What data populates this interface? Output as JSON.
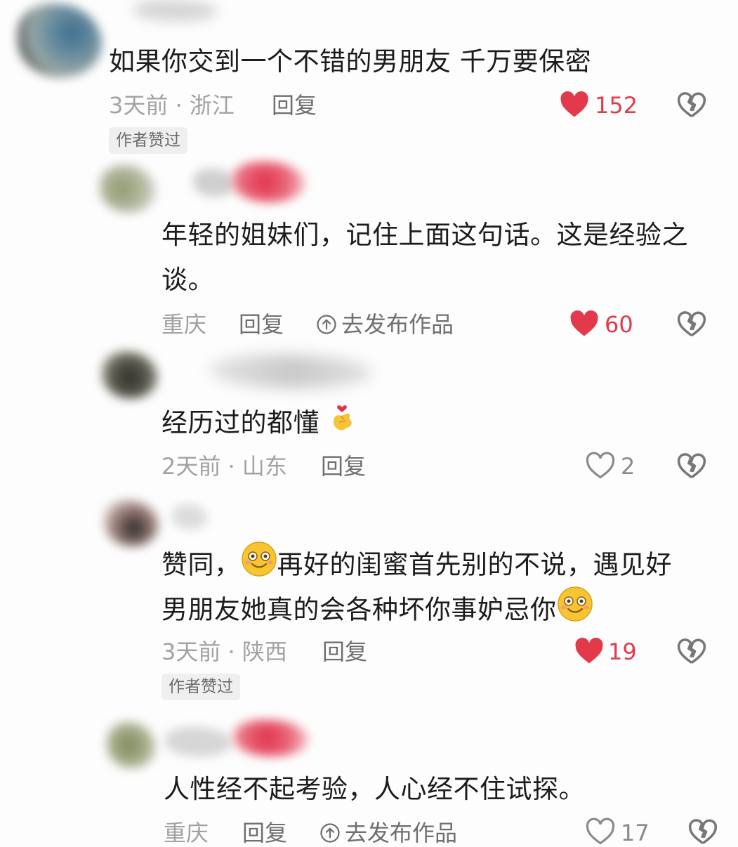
{
  "comments": [
    {
      "text_lines": [
        "如果你交到一个不错的男朋友 千万要保密"
      ],
      "meta": "3天前 · 浙江",
      "reply": "回复",
      "likes": "152",
      "liked": true,
      "badge": "作者赞过"
    },
    {
      "text_lines": [
        "年轻的姐妹们，记住上面这句话。这是经验之",
        "谈。"
      ],
      "meta": "重庆",
      "reply": "回复",
      "publish": "去发布作品",
      "likes": "60",
      "liked": true
    },
    {
      "text_lines": [
        "经历过的都懂"
      ],
      "meta": "2天前 · 山东",
      "reply": "回复",
      "likes": "2",
      "liked": false
    },
    {
      "text_lines": [
        "赞同，",
        "再好的闺蜜首先别的不说，遇见好",
        "男朋友她真的会各种坏你事妒忌你"
      ],
      "meta": "3天前 · 陕西",
      "reply": "回复",
      "likes": "19",
      "liked": true,
      "badge": "作者赞过"
    },
    {
      "text_lines": [
        "人性经不起考验，人心经不住试探。"
      ],
      "meta": "重庆",
      "reply": "回复",
      "publish": "去发布作品",
      "likes": "17",
      "liked": false
    }
  ],
  "icons": {
    "like_filled": "heart-filled-icon",
    "like_outline": "heart-outline-icon",
    "dislike": "broken-heart-icon",
    "publish": "upload-circle-icon",
    "emoji_heart_hand": "finger-heart-emoji",
    "emoji_smile": "smiling-face-emoji"
  },
  "colors": {
    "like_red": "#e33a4b",
    "meta_gray": "#a2a2a2",
    "reply_gray": "#6f6f6f",
    "badge_bg": "#efefef"
  }
}
